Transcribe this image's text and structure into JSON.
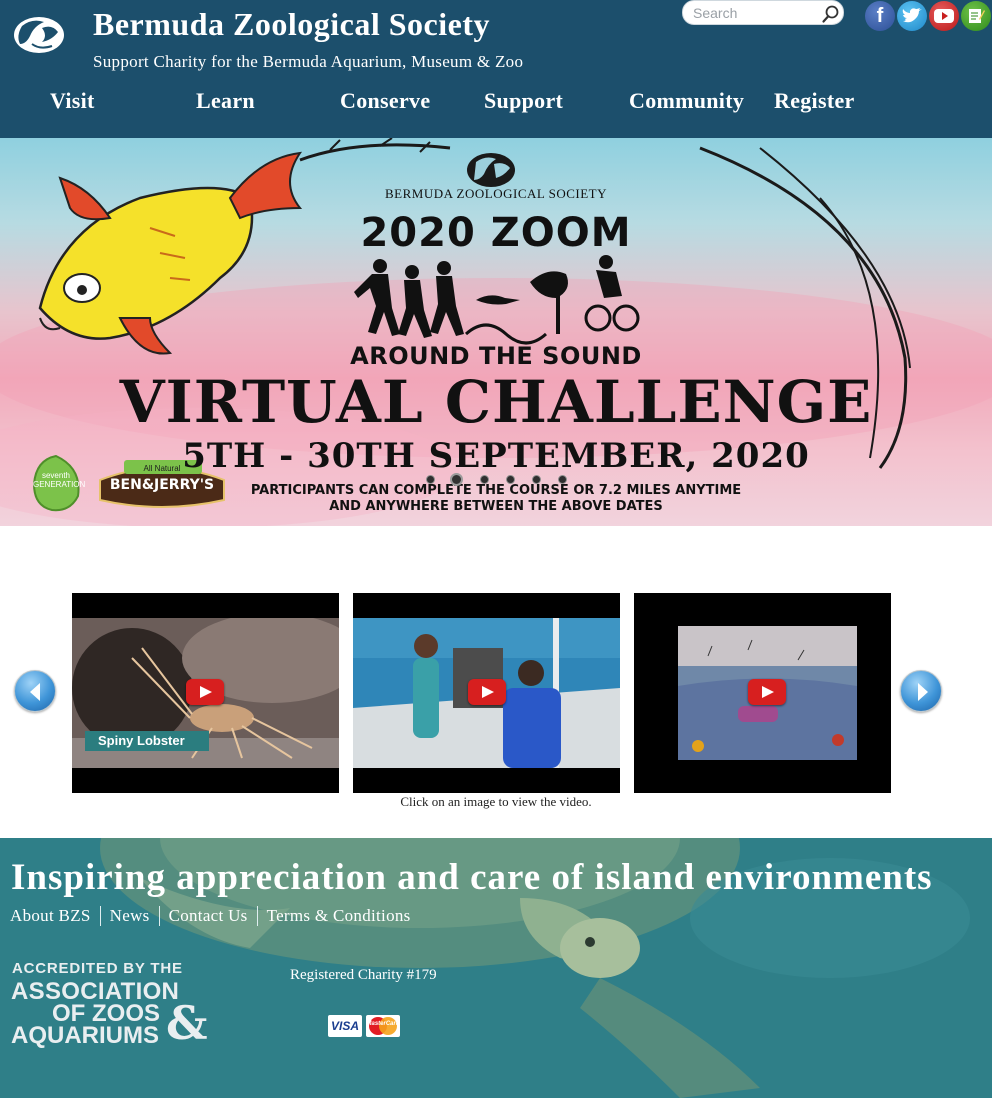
{
  "header": {
    "title": "Bermuda Zoological Society",
    "subtitle": "Support Charity for the Bermuda Aquarium, Museum & Zoo",
    "logo_icon": "fish-logo-icon",
    "search": {
      "placeholder": "Search",
      "value": "",
      "icon": "search-icon"
    },
    "social": [
      {
        "name": "facebook",
        "icon": "facebook-icon",
        "color": "#3b5998"
      },
      {
        "name": "twitter",
        "icon": "twitter-icon",
        "color": "#1da1f2"
      },
      {
        "name": "youtube",
        "icon": "youtube-icon",
        "color": "#cc181e"
      },
      {
        "name": "blog",
        "icon": "blog-icon",
        "color": "#3a9a24"
      }
    ],
    "nav": [
      {
        "label": "Visit"
      },
      {
        "label": "Learn"
      },
      {
        "label": "Conserve"
      },
      {
        "label": "Support"
      },
      {
        "label": "Community"
      },
      {
        "label": "Register"
      }
    ],
    "colors": {
      "header_bg": "#1c4f6c",
      "text": "#ffffff"
    }
  },
  "hero": {
    "org": "BERMUDA ZOOLOGICAL SOCIETY",
    "headline": "2020 ZOOM",
    "subheadline": "AROUND THE SOUND",
    "title": "VIRTUAL CHALLENGE",
    "dates": "5TH - 30TH SEPTEMBER, 2020",
    "note_line1": "PARTICIPANTS CAN COMPLETE THE COURSE OR 7.2 MILES ANYTIME",
    "note_line2": "AND ANYWHERE BETWEEN THE ABOVE DATES",
    "sponsors": {
      "seventh_generation": "seventh GENERATION",
      "benjerry_tag": "All Natural",
      "benjerry_name": "BEN&JERRY'S"
    },
    "slider": {
      "total_slides": 6,
      "active_slide": 2
    }
  },
  "videos": {
    "items": [
      {
        "caption": "Spiny Lobster",
        "play_icon": "play-icon"
      },
      {
        "caption": "",
        "play_icon": "play-icon"
      },
      {
        "caption": "",
        "play_icon": "play-icon"
      }
    ],
    "prev_icon": "arrow-left-icon",
    "next_icon": "arrow-right-icon",
    "hint": "Click on an image to view the video."
  },
  "footer": {
    "tagline": "Inspiring appreciation and care of island environments",
    "links": [
      {
        "label": "About BZS"
      },
      {
        "label": "News"
      },
      {
        "label": "Contact Us"
      },
      {
        "label": "Terms & Conditions"
      }
    ],
    "aza": {
      "line1": "ACCREDITED BY THE",
      "line2": "ASSOCIATION",
      "line3": "OF ZOOS",
      "line4": "AQUARIUMS",
      "amp": "&"
    },
    "charity": "Registered Charity #179",
    "payment": {
      "visa": "VISA",
      "mastercard": "MasterCard"
    },
    "colors": {
      "footer_bg": "#34858e"
    }
  }
}
